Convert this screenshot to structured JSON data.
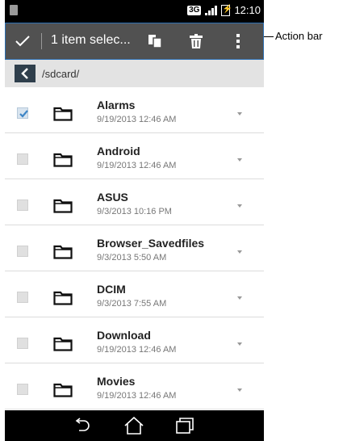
{
  "status_bar": {
    "network": "3G",
    "time": "12:10"
  },
  "action_bar": {
    "selection_title": "1 item selec..."
  },
  "path_bar": {
    "path": "/sdcard/"
  },
  "files": [
    {
      "name": "Alarms",
      "date": "9/19/2013 12:46 AM",
      "checked": true
    },
    {
      "name": "Android",
      "date": "9/19/2013 12:46 AM",
      "checked": false
    },
    {
      "name": "ASUS",
      "date": "9/3/2013 10:16 PM",
      "checked": false
    },
    {
      "name": "Browser_Savedfiles",
      "date": "9/3/2013 5:50 AM",
      "checked": false
    },
    {
      "name": "DCIM",
      "date": "9/3/2013 7:55 AM",
      "checked": false
    },
    {
      "name": "Download",
      "date": "9/19/2013 12:46 AM",
      "checked": false
    },
    {
      "name": "Movies",
      "date": "9/19/2013 12:46 AM",
      "checked": false
    }
  ],
  "annotation": {
    "label": "Action bar"
  },
  "colors": {
    "action_bar_bg": "#515151",
    "highlight_border": "#2d6fb2",
    "up_button_bg": "#2f3f4c"
  }
}
